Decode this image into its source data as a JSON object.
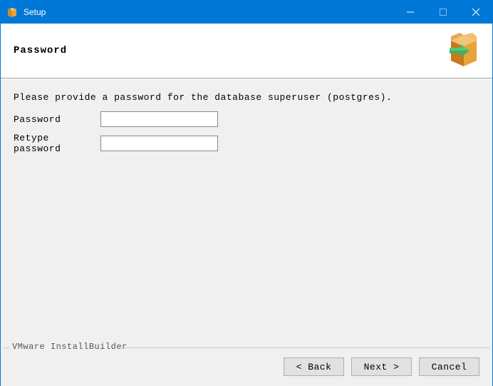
{
  "titlebar": {
    "title": "Setup"
  },
  "header": {
    "title": "Password"
  },
  "content": {
    "instruction": "Please provide a password for the database superuser (postgres).",
    "password_label": "Password",
    "password_value": "",
    "retype_label": "Retype password",
    "retype_value": ""
  },
  "footer": {
    "vendor": "VMware InstallBuilder",
    "back": "< Back",
    "next": "Next >",
    "cancel": "Cancel"
  }
}
